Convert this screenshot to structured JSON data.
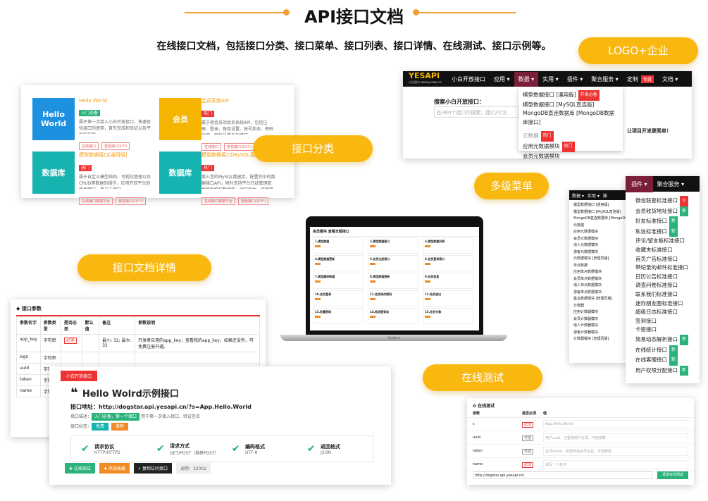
{
  "header": {
    "title": "API接口文档",
    "subtitle": "在线接口文档，包括接口分类、接口菜单、接口列表、接口详情、在线测试、接口示例等。"
  },
  "pills": {
    "logo": "LOGO+企业",
    "category": "接口分类",
    "menu": "多级菜单",
    "detail": "接口文档详情",
    "test": "在线测试"
  },
  "colors": {
    "accent": "#f9b810",
    "blue": "#1e90e0",
    "orange": "#f5b400",
    "teal": "#17b3b0"
  },
  "category_panel": {
    "items": [
      {
        "box": "Hello World",
        "title": "Hello World",
        "tag": "入门必备",
        "desc": "属于第一次接入小白开放接口，快速体验接口的使用，首先完成和验证以及平台的环境。",
        "btn1": "在线接口",
        "btn2": "查看接口(1个)"
      },
      {
        "box": "会员",
        "title": "会员系统API",
        "tag": "热门",
        "desc": "属于搭会员的会员系统API，包括注册、登录、角色设置、账号状态、密码找回、解封号等系列接口。",
        "btn1": "在线接口",
        "btn2": "查看接口(10个)"
      },
      {
        "box": "数据库",
        "title": "模型数据接口[通用版]",
        "tag": "热门",
        "desc": "属于自定义模型结构，可视化管理以及CRUD等数据的操作，应用开放平台的使用接口，用户方接口。",
        "btn1": "在线接口数据平台",
        "btn2": "查看接口(10个)"
      },
      {
        "box": "数据库",
        "title": "模型数据接口[MySQL直连版]",
        "tag": "热门",
        "desc": "填入您的MySQL数据库，配置完毕的数据接口API，同时支持平台在线管理数据库和维护数据库，功能强大，使用简单！",
        "btn1": "在线接口数据平台",
        "btn2": "查看接口(10个)"
      }
    ]
  },
  "logo_panel": {
    "brand": "YESAPI",
    "brand_sub": "小白接口 www.yesapi.cn",
    "nav": [
      "小白开放接口",
      "应用 ▾",
      "数据 ▾",
      "实用 ▾",
      "插件 ▾",
      "聚合服务 ▾",
      "定制",
      "文档 ▾"
    ],
    "nav_badge": "专属",
    "search_label": "搜索小白开放接口：",
    "search_placeholder": "在360个接口中搜索：接口/中文",
    "dropdown": [
      {
        "label": "模型数据接口 [通用版]",
        "badge": "开发必备"
      },
      {
        "label": "模型数据接口 [MySQL直连版]",
        "badge": ""
      },
      {
        "label": "MongoDB直连数据库 [MongoDB数据库接口]",
        "badge": ""
      },
      {
        "label": "元数据",
        "badge": "热门"
      },
      {
        "label": "应用元数据模块",
        "badge": "热门"
      },
      {
        "label": "会员元数据模块",
        "badge": ""
      }
    ],
    "side_text": "让项目开发更简单！"
  },
  "menu_panel": {
    "header": [
      "插件 ▾",
      "聚合服务 ▾"
    ],
    "items": [
      {
        "label": "微信联登标准接口",
        "badge": "火",
        "type": "red"
      },
      {
        "label": "会员收货地址接口",
        "badge": "新",
        "type": "green"
      },
      {
        "label": "好友标准接口",
        "badge": "新",
        "type": "green"
      },
      {
        "label": "私信标准接口",
        "badge": "新",
        "type": "green"
      },
      {
        "label": "评论/留言板标准接口",
        "badge": "",
        "type": ""
      },
      {
        "label": "收藏夹标准接口",
        "badge": "",
        "type": ""
      },
      {
        "label": "首页广告标准接口",
        "badge": "",
        "type": ""
      },
      {
        "label": "带纪录的邮件标准接口",
        "badge": "",
        "type": ""
      },
      {
        "label": "日历公告标准接口",
        "badge": "",
        "type": ""
      },
      {
        "label": "调查问卷标准接口",
        "badge": "",
        "type": ""
      },
      {
        "label": "联系我们标准接口",
        "badge": "",
        "type": ""
      },
      {
        "label": "迷你朋友圈标准接口",
        "badge": "",
        "type": ""
      },
      {
        "label": "超级日志标准接口",
        "badge": "",
        "type": ""
      },
      {
        "label": "签到接口",
        "badge": "",
        "type": ""
      },
      {
        "label": "卡密接口",
        "badge": "",
        "type": ""
      },
      {
        "label": "简易动态解析接口",
        "badge": "新",
        "type": "green"
      },
      {
        "label": "在线统计接口",
        "badge": "新",
        "type": "green"
      },
      {
        "label": "在线客服接口",
        "badge": "新",
        "type": "green"
      },
      {
        "label": "用户权限分配接口",
        "badge": "新",
        "type": "green"
      }
    ],
    "back_nav": [
      "数据 ▾",
      "实用 ▾",
      "插"
    ],
    "back_items": [
      "模型数据接口 [通用版]",
      "模型数据接口 [MySQL直连版]",
      "MongoDB直连数据库 [MongoDB",
      "元数据",
      "应用元数据模块",
      "会员元数据模块",
      "他人元数据模块",
      "游客元数据模块",
      "元数据模块 [管理员版]",
      "单点数据",
      "应用单点数据模块",
      "会员单点数据模块",
      "他人单点数据模块",
      "游客单点数据模块",
      "集合数据模块 [管理员版]",
      "计数器",
      "应用计数器模块",
      "会员计数器模块",
      "他人计数器模块",
      "游客计数器模块",
      "计数器模块 [管理员版]"
    ]
  },
  "detail_panel": {
    "section": "◆ 接口参数",
    "headers": [
      "参数名字",
      "参数类型",
      "是否必须",
      "默认值",
      "备注",
      "参数说明"
    ],
    "rows": [
      {
        "name": "app_key",
        "type": "字符串",
        "req": "必须",
        "def": "",
        "note": "最小: 32; 最大: 32",
        "desc": "开发者应用的app_key，查看我的app_key，如果还没有，可免费注册开通。"
      },
      {
        "name": "sign",
        "type": "字符串",
        "req": "",
        "def": "",
        "note": "",
        "desc": ""
      },
      {
        "name": "uuid",
        "type": "字符串",
        "req": "",
        "def": "",
        "note": "",
        "desc": ""
      },
      {
        "name": "token",
        "type": "字符串",
        "req": "",
        "def": "",
        "note": "",
        "desc": ""
      },
      {
        "name": "name",
        "type": "字符串",
        "req": "",
        "def": "",
        "note": "",
        "desc": ""
      }
    ]
  },
  "example_panel": {
    "ribbon": "小白开放接口",
    "title": "Hello Wolrd示例接口",
    "address_label": "接口地址：",
    "address": "http://dogstar.api.yesapi.cn/?s=App.Hello.World",
    "desc_label": "接口描述：",
    "desc_tag": "入门必备，第一个接口",
    "desc_text": "用于第一次接入接口，验证签名",
    "tags_label": "接口标签：",
    "tags": [
      "免费",
      "推荐"
    ],
    "features": [
      {
        "title": "请求协议",
        "value": "HTTP/HTTPS"
      },
      {
        "title": "请求方式",
        "value": "GET/POST（推荐POST）"
      },
      {
        "title": "编码格式",
        "value": "UTF-8"
      },
      {
        "title": "返回格式",
        "value": "JSON"
      }
    ],
    "buttons": [
      "✚ 在线测试",
      "✚ 添加收藏",
      "⚡ 复制访问接口"
    ],
    "count_label": "调用：",
    "count": "32002"
  },
  "test_panel": {
    "section": "✿ 在线测试",
    "headers": [
      "参数",
      "是否必须",
      "值"
    ],
    "rows": [
      {
        "name": "s",
        "req": "必须",
        "val": "App.Hello.World"
      },
      {
        "name": "uuid",
        "req": "可选",
        "val": "用户uuid，已登录用户必须，可选参数"
      },
      {
        "name": "token",
        "req": "可选",
        "val": "会员token，如需传递会员信息，可选参数"
      },
      {
        "name": "name",
        "req": "必须",
        "val": "填写一个名字"
      }
    ],
    "url": "http://dogstar.api.yesapi.cn/",
    "submit": "请求在线测试"
  },
  "laptop": {
    "heading": "会员模块 查看全部接口",
    "base": "MacBook",
    "cells": [
      "1.模型数据",
      "2.模型数据接口",
      "3.模型数据列表",
      "4.模型数据更新",
      "5.会员注册接口",
      "6.会员登录接口",
      "7.模型删除数据",
      "8.模型数据更新",
      "9.会员信息",
      "10.会员登录",
      "11.会员修改密码",
      "12.会员退出",
      "13.批量获取",
      "14.检测登录态",
      "15.会员头像"
    ]
  }
}
